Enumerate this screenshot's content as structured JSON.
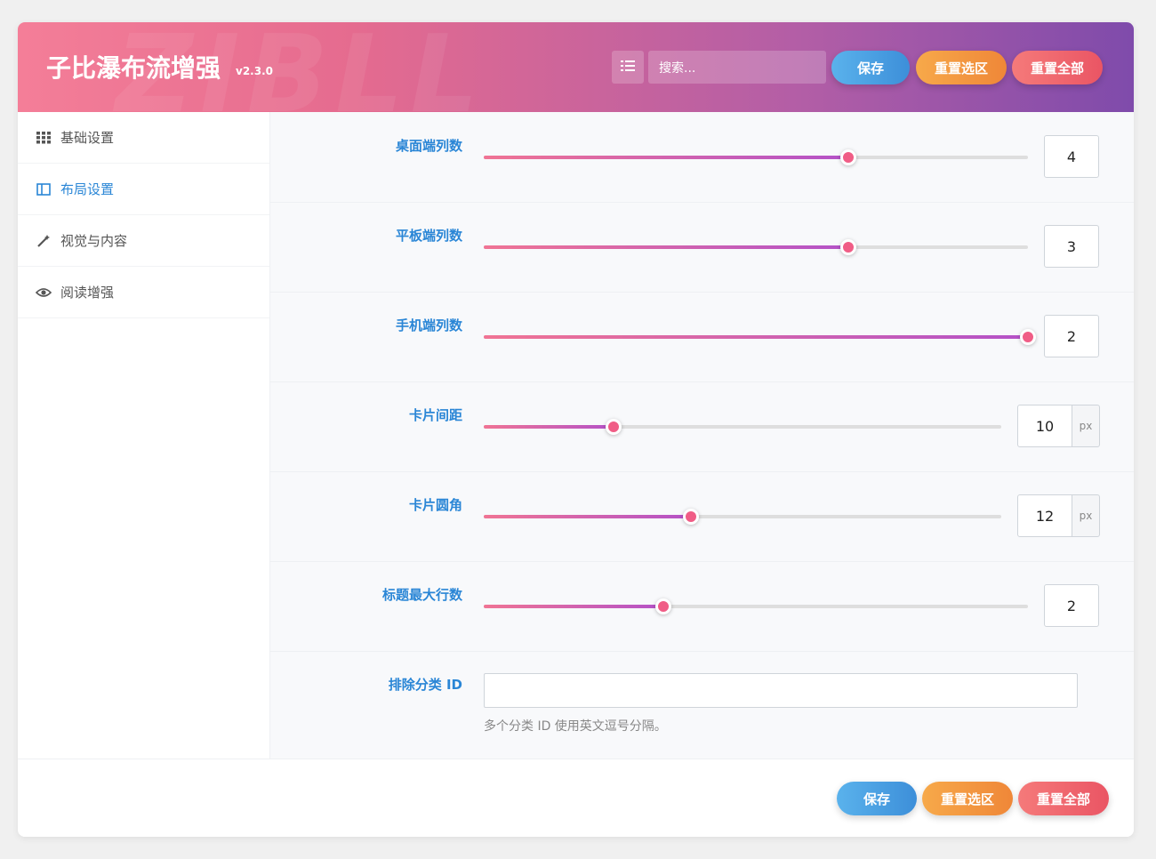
{
  "header": {
    "title": "子比瀑布流增强",
    "version": "v2.3.0",
    "watermark": "ZIBLL",
    "search_placeholder": "搜索...",
    "save_label": "保存",
    "reset_section_label": "重置选区",
    "reset_all_label": "重置全部"
  },
  "sidebar": {
    "items": [
      {
        "label": "基础设置",
        "icon": "grid-icon",
        "active": false
      },
      {
        "label": "布局设置",
        "icon": "columns-icon",
        "active": true
      },
      {
        "label": "视觉与内容",
        "icon": "magic-wand-icon",
        "active": false
      },
      {
        "label": "阅读增强",
        "icon": "eye-icon",
        "active": false
      }
    ]
  },
  "settings": {
    "desktop_columns": {
      "label": "桌面端列数",
      "value": "4",
      "fraction": 0.67
    },
    "tablet_columns": {
      "label": "平板端列数",
      "value": "3",
      "fraction": 0.67
    },
    "mobile_columns": {
      "label": "手机端列数",
      "value": "2",
      "fraction": 1.0
    },
    "card_gap": {
      "label": "卡片间距",
      "value": "10",
      "unit": "px",
      "fraction": 0.25
    },
    "card_radius": {
      "label": "卡片圆角",
      "value": "12",
      "unit": "px",
      "fraction": 0.4
    },
    "title_max_lines": {
      "label": "标题最大行数",
      "value": "2",
      "fraction": 0.33
    },
    "exclude_category": {
      "label": "排除分类 ID",
      "value": "",
      "hint": "多个分类 ID 使用英文逗号分隔。"
    }
  },
  "footer": {
    "save_label": "保存",
    "reset_section_label": "重置选区",
    "reset_all_label": "重置全部"
  },
  "colors": {
    "header_gradient_start": "#f47e98",
    "header_gradient_end": "#7f4bab",
    "accent_blue": "#2a86d6",
    "slider_thumb": "#f05d86"
  }
}
